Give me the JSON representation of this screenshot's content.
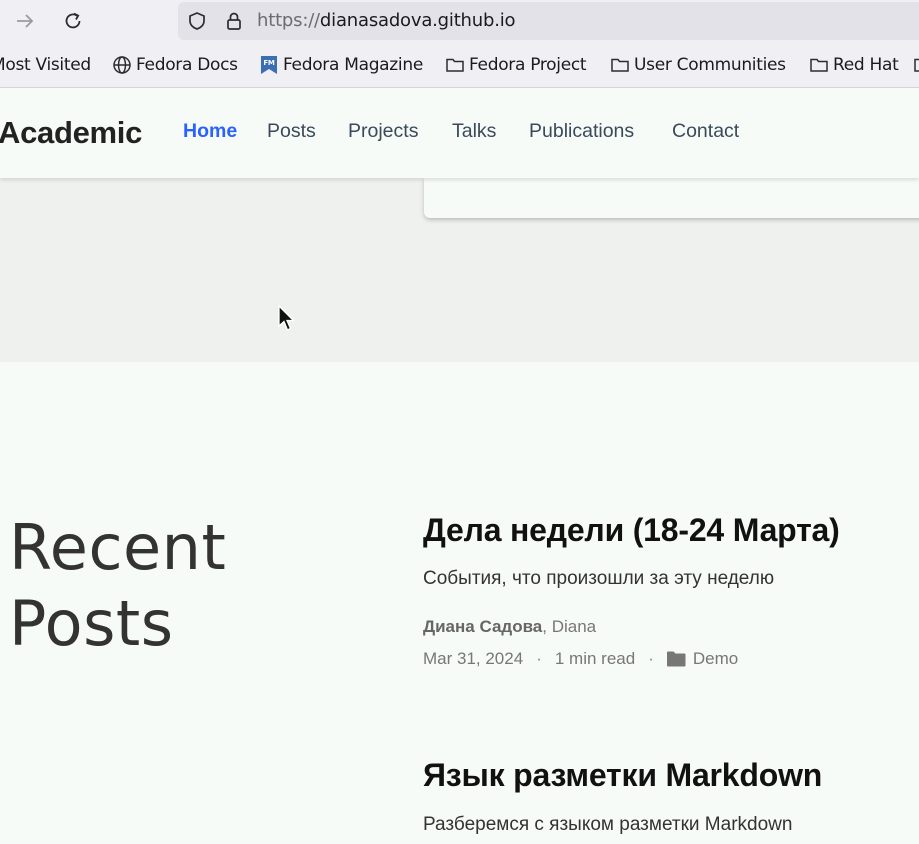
{
  "browser": {
    "url_scheme": "https://",
    "url_host": "dianasadova.github.io",
    "bookmarks": [
      {
        "label": "Most Visited",
        "icon": "none"
      },
      {
        "label": "Fedora Docs",
        "icon": "globe-icon"
      },
      {
        "label": "Fedora Magazine",
        "icon": "fedora-magazine-icon"
      },
      {
        "label": "Fedora Project",
        "icon": "folder-icon"
      },
      {
        "label": "User Communities",
        "icon": "folder-icon"
      },
      {
        "label": "Red Hat",
        "icon": "folder-icon"
      }
    ]
  },
  "site": {
    "brand": "Academic",
    "nav": [
      {
        "label": "Home",
        "active": true
      },
      {
        "label": "Posts"
      },
      {
        "label": "Projects"
      },
      {
        "label": "Talks"
      },
      {
        "label": "Publications"
      },
      {
        "label": "Contact"
      }
    ]
  },
  "recent": {
    "title_line1": "Recent",
    "title_line2": "Posts",
    "posts": [
      {
        "title": "Дела недели (18-24 Марта)",
        "summary": "События, что произошли за эту неделю",
        "author_main": "Диана Садова",
        "author_other": ", Diana",
        "date": "Mar 31, 2024",
        "read_time": "1 min read",
        "category": "Demo"
      },
      {
        "title": "Язык разметки Markdown",
        "summary": "Разберемся с языком разметки Markdown"
      }
    ]
  },
  "colors": {
    "accent": "#2962ff",
    "page_bg": "#f7fbf7",
    "hero_bg": "#eff1ef"
  }
}
